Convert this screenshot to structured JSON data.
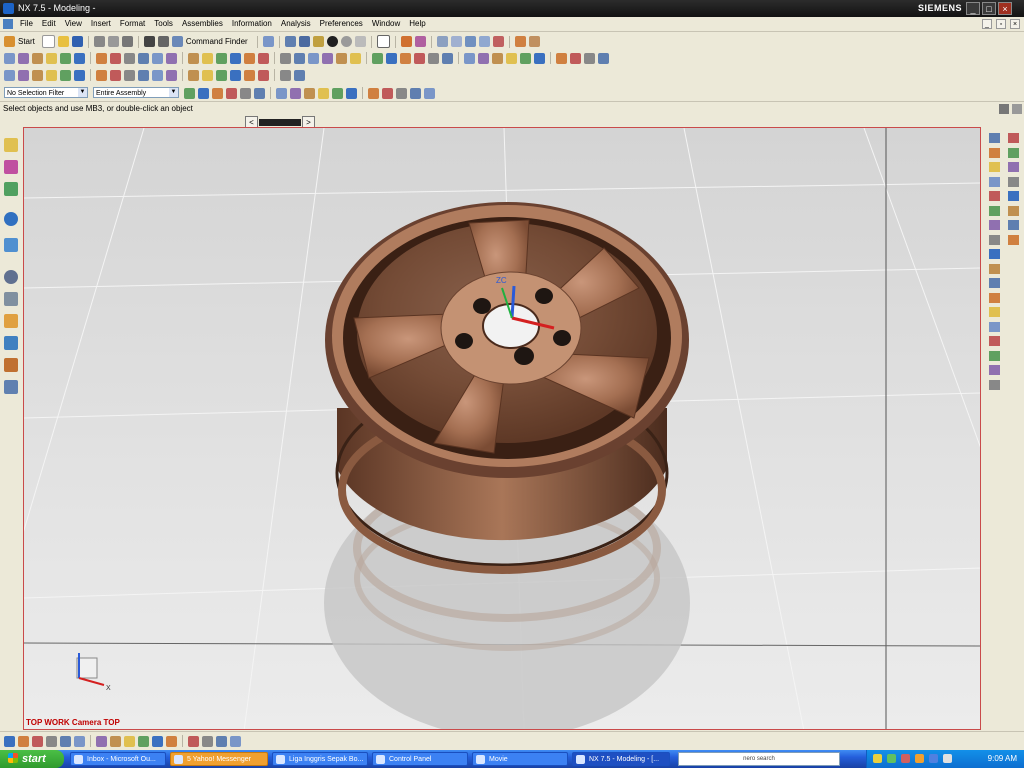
{
  "window": {
    "title": "NX 7.5 - Modeling -",
    "brand": "SIEMENS",
    "minimize": "_",
    "maximize": "□",
    "close": "×"
  },
  "menu": {
    "items": [
      "File",
      "Edit",
      "View",
      "Insert",
      "Format",
      "Tools",
      "Assemblies",
      "Information",
      "Analysis",
      "Preferences",
      "Window",
      "Help"
    ]
  },
  "toolbar": {
    "start_label": "Start",
    "command_finder_label": "Command Finder"
  },
  "selection": {
    "filter_value": "No Selection Filter",
    "scope_value": "Entire Assembly"
  },
  "cue": {
    "text": "Select objects and use MB3, or double-click an object"
  },
  "viewport": {
    "label": "TOP WORK Camera TOP",
    "csys_x": "X",
    "triad_z": "ZC"
  },
  "colors": {
    "viewport_border": "#c94a4a",
    "wheel_bronze": "#a8714a",
    "floor": "#dcdcdc"
  },
  "taskbar": {
    "start": "start",
    "tasks": [
      {
        "label": "Inbox - Microsoft Ou...",
        "state": "normal"
      },
      {
        "label": "5 Yahoo! Messenger",
        "state": "flash"
      },
      {
        "label": "Liga Inggris Sepak Bo...",
        "state": "normal"
      },
      {
        "label": "Control Panel",
        "state": "normal"
      },
      {
        "label": "Movie",
        "state": "normal"
      },
      {
        "label": "NX 7.5 - Modeling - [...",
        "state": "active"
      }
    ],
    "search_label": "nero search",
    "clock": "9:09 AM"
  }
}
